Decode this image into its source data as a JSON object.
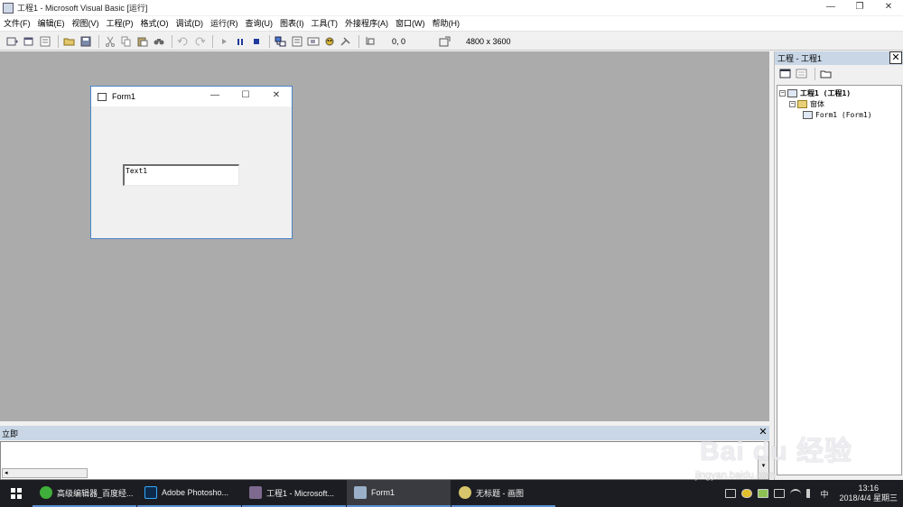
{
  "window": {
    "title": "工程1 - Microsoft Visual Basic [运行]",
    "minimize_glyph": "—",
    "restore_glyph": "❐",
    "close_glyph": "✕"
  },
  "menu": [
    "文件(F)",
    "编辑(E)",
    "视图(V)",
    "工程(P)",
    "格式(O)",
    "调试(D)",
    "运行(R)",
    "查询(U)",
    "图表(I)",
    "工具(T)",
    "外接程序(A)",
    "窗口(W)",
    "帮助(H)"
  ],
  "toolbar": {
    "coords": "0, 0",
    "size": "4800 x 3600"
  },
  "form1": {
    "caption": "Form1",
    "textbox_value": "Text1",
    "minimize_glyph": "—",
    "maximize_glyph": "☐",
    "close_glyph": "✕"
  },
  "project": {
    "title": "工程 - 工程1",
    "close_glyph": "✕",
    "tree": {
      "root": "工程1 (工程1)",
      "folder": "窗体",
      "item": "Form1 (Form1)",
      "expand_glyph": "−"
    }
  },
  "immediate": {
    "title": "立即",
    "close_glyph": "✕",
    "scroll_left": "◂",
    "scroll_down": "▾"
  },
  "taskbar": {
    "tasks": [
      {
        "label": "高级编辑器_百度经...",
        "color": "#3fae3a"
      },
      {
        "label": "Adobe Photosho...",
        "color": "#0d2a4a"
      },
      {
        "label": "工程1 - Microsoft...",
        "color": "#7d6a8e"
      },
      {
        "label": "Form1",
        "color": "#9ab0c8"
      },
      {
        "label": "无标题 - 画图",
        "color": "#d8c46a"
      }
    ],
    "ime": "中",
    "time": "13:16",
    "date": "2018/4/4 星期三"
  },
  "watermark": {
    "main": "Bai du 经验",
    "url": "jingyan.baidu.com"
  }
}
